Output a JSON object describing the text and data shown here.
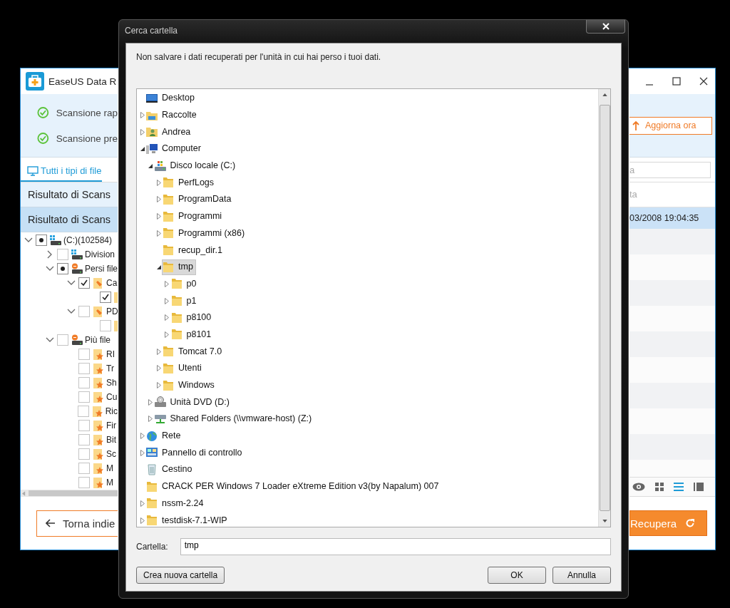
{
  "background_window": {
    "title": "EaseUS Data R",
    "scans": [
      {
        "label": "Scansione rap",
        "done": true
      },
      {
        "label": "Scansione pre",
        "done": true
      }
    ],
    "update_button": "Aggiorna ora",
    "file_type_tab": {
      "label": "Tutti i tipi di file",
      "selected": true
    },
    "result_rows": [
      {
        "label": "Risultato di Scans",
        "selected": false
      },
      {
        "label": "Risultato di Scans",
        "selected": true
      }
    ],
    "search": {
      "placeholder": "a"
    },
    "column_header": "ta",
    "file_rows": [
      {
        "date": "03/2008 19:04:35",
        "selected": true
      }
    ],
    "tree": [
      {
        "label": "(C:)(102584)",
        "kind": "drive",
        "expanded": true,
        "checked": true,
        "partial": true,
        "children": [
          {
            "label": "Division",
            "kind": "drive",
            "expanded": false,
            "checked": false
          },
          {
            "label": "Persi file",
            "kind": "lost-drive",
            "expanded": true,
            "checked": true,
            "partial": true,
            "children": [
              {
                "label": "Ca",
                "kind": "tag",
                "expanded": true,
                "checked": true,
                "children": [
                  {
                    "kind": "folder",
                    "checked": true
                  }
                ]
              },
              {
                "label": "PD",
                "kind": "tag",
                "expanded": true,
                "checked": false,
                "children": [
                  {
                    "kind": "folder",
                    "checked": false
                  }
                ]
              }
            ]
          },
          {
            "label": "Più file",
            "kind": "lost-drive",
            "expanded": true,
            "checked": false,
            "children": [
              {
                "label": "RI",
                "kind": "star-folder",
                "checked": false
              },
              {
                "label": "Tr",
                "kind": "star-folder",
                "checked": false
              },
              {
                "label": "Sh",
                "kind": "star-folder",
                "checked": false
              },
              {
                "label": "Cu",
                "kind": "star-folder",
                "checked": false
              },
              {
                "label": "Ric",
                "kind": "star-folder",
                "checked": false
              },
              {
                "label": "Fir",
                "kind": "star-folder",
                "checked": false
              },
              {
                "label": "Bit",
                "kind": "star-folder",
                "checked": false
              },
              {
                "label": "Sc",
                "kind": "star-folder",
                "checked": false
              },
              {
                "label": "M",
                "kind": "star-folder",
                "checked": false
              },
              {
                "label": "M",
                "kind": "star-folder",
                "checked": false
              }
            ]
          }
        ]
      }
    ],
    "view_modes": [
      {
        "kind": "preview",
        "selected": false
      },
      {
        "kind": "thumbnails",
        "selected": false
      },
      {
        "kind": "list",
        "selected": true
      },
      {
        "kind": "details",
        "selected": false
      }
    ],
    "back_button": "Torna indie",
    "recover_button": "Recupera"
  },
  "dialog": {
    "title": "Cerca cartella",
    "message": "Non salvare i dati recuperati per l'unità in cui hai perso i tuoi dati.",
    "tree": [
      {
        "label": "Desktop",
        "kind": "desktop",
        "selected": false
      },
      {
        "label": "Raccolte",
        "kind": "library",
        "expanded": false,
        "selected": false
      },
      {
        "label": "Andrea",
        "kind": "user",
        "expanded": false,
        "selected": false
      },
      {
        "label": "Computer",
        "kind": "computer",
        "expanded": true,
        "selected": false,
        "children": [
          {
            "label": "Disco locale (C:)",
            "kind": "system-drive",
            "expanded": true,
            "selected": false,
            "children": [
              {
                "label": "PerfLogs",
                "kind": "folder",
                "expanded": false,
                "selected": false
              },
              {
                "label": "ProgramData",
                "kind": "folder",
                "expanded": false,
                "selected": false
              },
              {
                "label": "Programmi",
                "kind": "folder",
                "expanded": false,
                "selected": false
              },
              {
                "label": "Programmi (x86)",
                "kind": "folder",
                "expanded": false,
                "selected": false
              },
              {
                "label": "recup_dir.1",
                "kind": "folder",
                "selected": false
              },
              {
                "label": "tmp",
                "kind": "folder",
                "expanded": true,
                "selected": true,
                "children": [
                  {
                    "label": "p0",
                    "kind": "folder",
                    "expanded": false,
                    "selected": false
                  },
                  {
                    "label": "p1",
                    "kind": "folder",
                    "expanded": false,
                    "selected": false
                  },
                  {
                    "label": "p8100",
                    "kind": "folder",
                    "expanded": false,
                    "selected": false
                  },
                  {
                    "label": "p8101",
                    "kind": "folder",
                    "expanded": false,
                    "selected": false
                  }
                ]
              },
              {
                "label": "Tomcat 7.0",
                "kind": "folder",
                "expanded": false,
                "selected": false
              },
              {
                "label": "Utenti",
                "kind": "folder",
                "expanded": false,
                "selected": false
              },
              {
                "label": "Windows",
                "kind": "folder",
                "expanded": false,
                "selected": false
              }
            ]
          },
          {
            "label": "Unità DVD (D:)",
            "kind": "dvd",
            "expanded": false,
            "selected": false
          },
          {
            "label": "Shared Folders (\\\\vmware-host) (Z:)",
            "kind": "network-drive",
            "expanded": false,
            "selected": false
          }
        ]
      },
      {
        "label": "Rete",
        "kind": "network",
        "expanded": false,
        "selected": false
      },
      {
        "label": "Pannello di controllo",
        "kind": "control-panel",
        "expanded": false,
        "selected": false
      },
      {
        "label": "Cestino",
        "kind": "recycle-bin",
        "selected": false
      },
      {
        "label": "CRACK PER Windows 7 Loader eXtreme Edition v3(by Napalum) 007",
        "kind": "folder",
        "selected": false
      },
      {
        "label": "nssm-2.24",
        "kind": "folder",
        "expanded": false,
        "selected": false
      },
      {
        "label": "testdisk-7.1-WIP",
        "kind": "folder",
        "expanded": false,
        "selected": false
      }
    ],
    "folder_field": {
      "label": "Cartella:",
      "value": "tmp"
    },
    "new_folder_button": "Crea nuova cartella",
    "ok_button": "OK",
    "cancel_button": "Annulla"
  }
}
